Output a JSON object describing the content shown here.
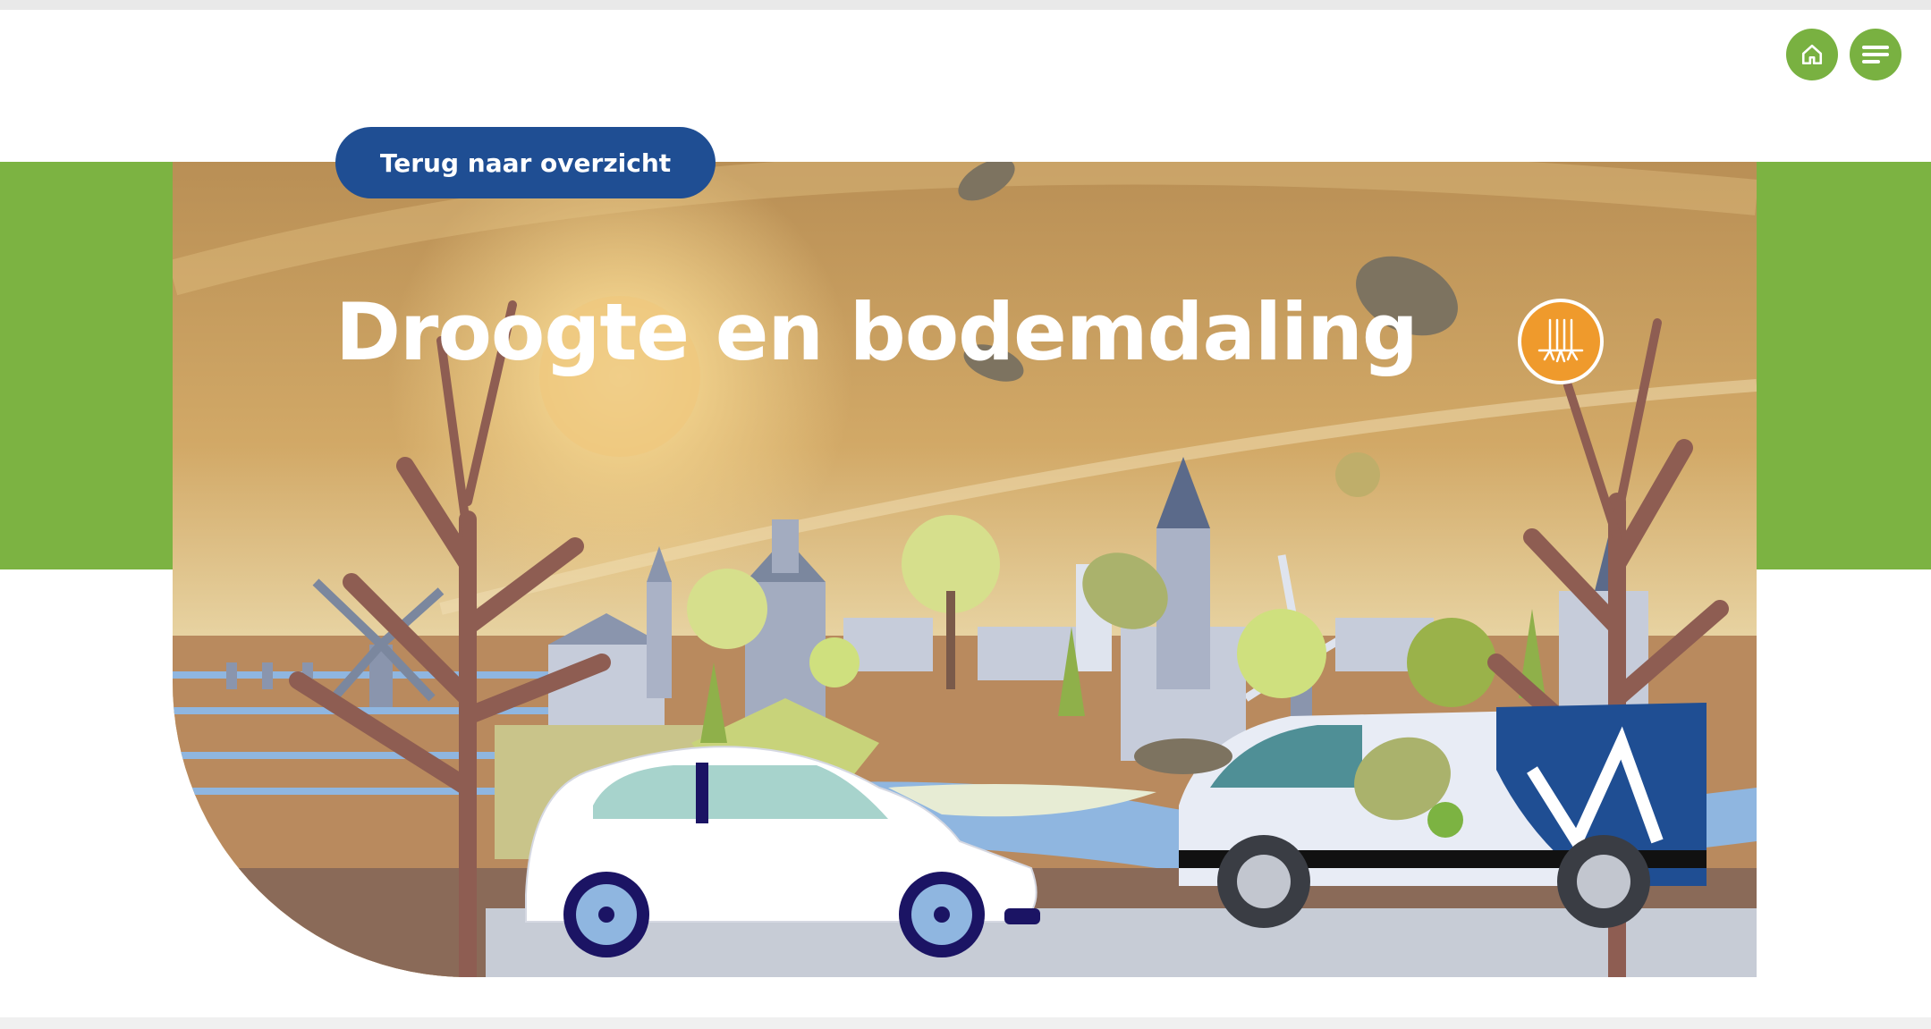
{
  "header": {
    "home_button": {
      "icon": "home-icon"
    },
    "menu_button": {
      "icon": "menu-icon"
    }
  },
  "hero": {
    "back_button_label": "Terug naar overzicht",
    "title": "Droogte en bodemdaling",
    "theme_icon": "drought-roots-icon",
    "illustration": "autumn-landscape-illustration"
  },
  "colors": {
    "brand_green": "#7cb342",
    "button_blue": "#1f4e93",
    "badge_orange": "#ef9a2c"
  }
}
